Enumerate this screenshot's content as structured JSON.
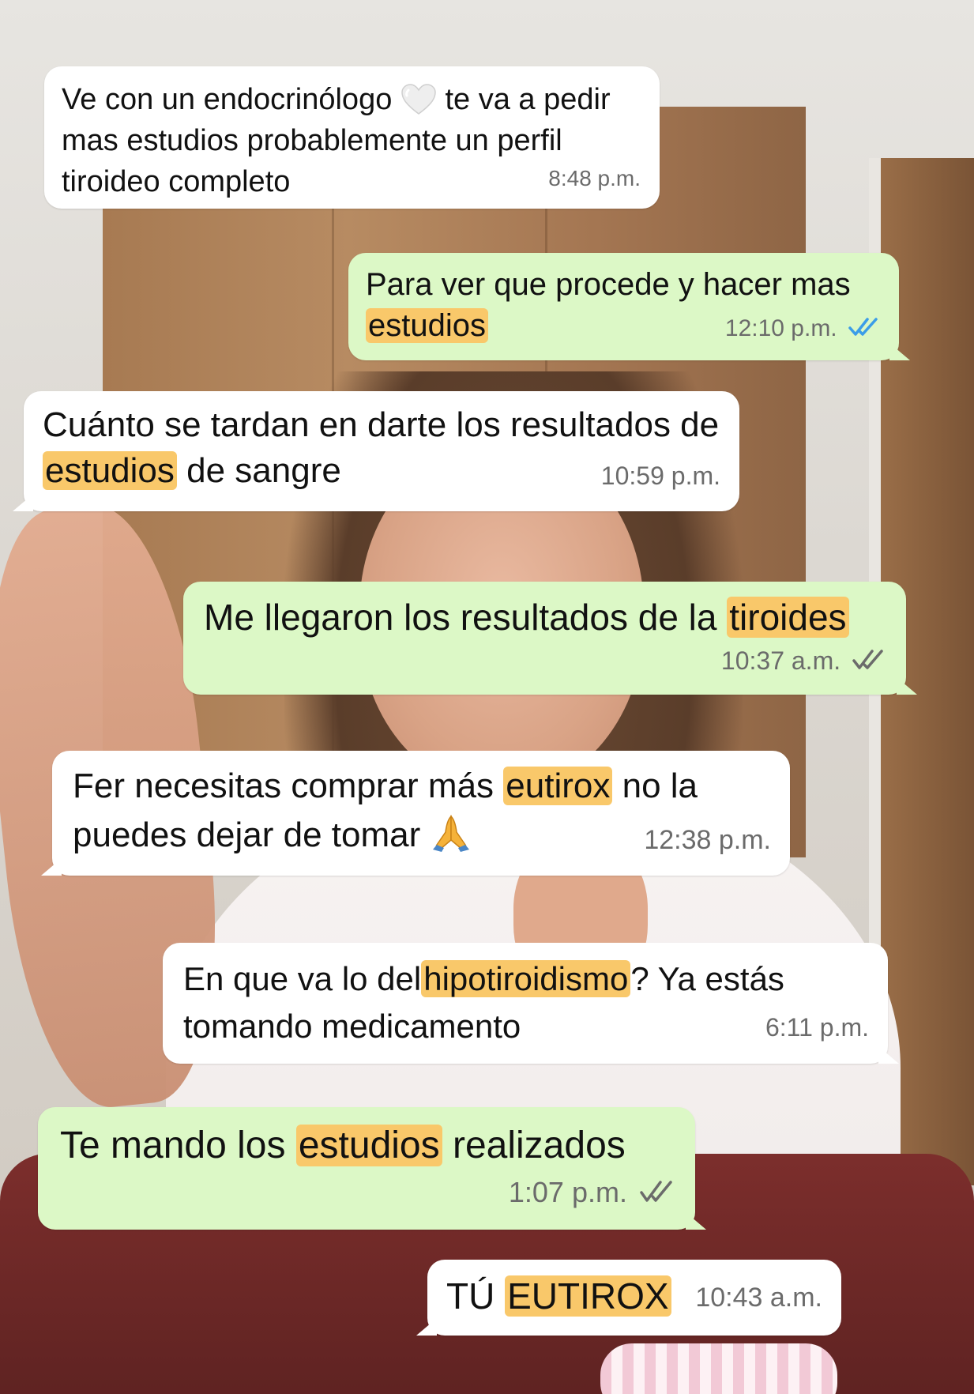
{
  "colors": {
    "incoming_bubble": "#ffffff",
    "outgoing_bubble": "#dcf8c6",
    "highlight": "#f9c86a",
    "read_tick": "#3b9de8",
    "delivered_tick": "#6b6b6b"
  },
  "messages": [
    {
      "direction": "incoming",
      "text_a": "Ve con un endocrinólogo",
      "emoji": "white-heart-icon",
      "text_b": "te va a pedir mas estudios probablemente un perfil tiroideo completo",
      "time": "8:48 p.m."
    },
    {
      "direction": "outgoing",
      "text": "Para ver que procede y hacer mas",
      "highlight": "estudios",
      "time": "12:10 p.m.",
      "status": "read"
    },
    {
      "direction": "incoming",
      "text_a": "Cuánto se tardan en darte los resultados de",
      "highlight": "estudios",
      "text_b": "de sangre",
      "time": "10:59 p.m."
    },
    {
      "direction": "outgoing",
      "text": "Me llegaron los resultados de la",
      "highlight": "tiroides",
      "time": "10:37 a.m.",
      "status": "delivered"
    },
    {
      "direction": "incoming",
      "text_a": "Fer necesitas comprar más",
      "highlight": "eutirox",
      "text_b": "no la puedes dejar de tomar",
      "emoji": "folded-hands-icon",
      "time": "12:38 p.m."
    },
    {
      "direction": "incoming",
      "text_a": "En que va lo del",
      "highlight": "hipotiroidismo",
      "text_b": "? Ya estás tomando medicamento",
      "time": "6:11 p.m."
    },
    {
      "direction": "outgoing",
      "text_a": "Te mando los",
      "highlight": "estudios",
      "text_b": "realizados",
      "time": "1:07 p.m.",
      "status": "delivered"
    },
    {
      "direction": "incoming",
      "text_a": "TÚ",
      "highlight": "EUTIROX",
      "time": "10:43 a.m."
    }
  ]
}
